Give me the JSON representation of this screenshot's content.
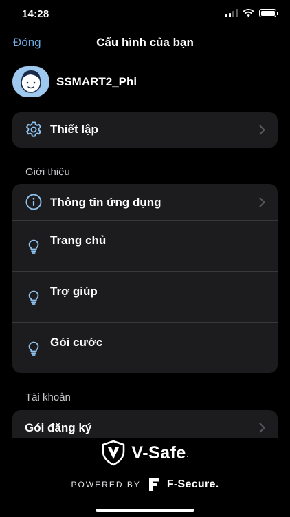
{
  "status_bar": {
    "time": "14:28"
  },
  "nav": {
    "close_label": "Đóng",
    "title": "Cấu hình của bạn"
  },
  "profile": {
    "name": "SSMART2_Phi"
  },
  "settings_card": {
    "label": "Thiết lập",
    "icon": "gear-icon"
  },
  "about_section": {
    "header": "Giới thiệu",
    "items": [
      {
        "label": "Thông tin ứng dụng",
        "icon": "info-icon",
        "has_chevron": true
      },
      {
        "label": "Trang chủ",
        "icon": "lightbulb-icon",
        "has_chevron": false
      },
      {
        "label": "Trợ giúp",
        "icon": "lightbulb-icon",
        "has_chevron": false
      },
      {
        "label": "Gói cước",
        "icon": "lightbulb-icon",
        "has_chevron": false
      }
    ]
  },
  "account_section": {
    "header": "Tài khoản",
    "items": [
      {
        "label": "Gói đăng ký",
        "has_chevron": true
      }
    ]
  },
  "footer": {
    "brand": "V-Safe",
    "brand_mark": ".",
    "powered_by": "POWERED BY",
    "partner": "F-Secure",
    "partner_mark": "."
  },
  "colors": {
    "background": "#000000",
    "card": "#1c1c1e",
    "accent": "#6ea9e0",
    "icon": "#8fc3ef",
    "chevron": "#5a5a5e",
    "avatar_bg": "#9ec8ee"
  }
}
